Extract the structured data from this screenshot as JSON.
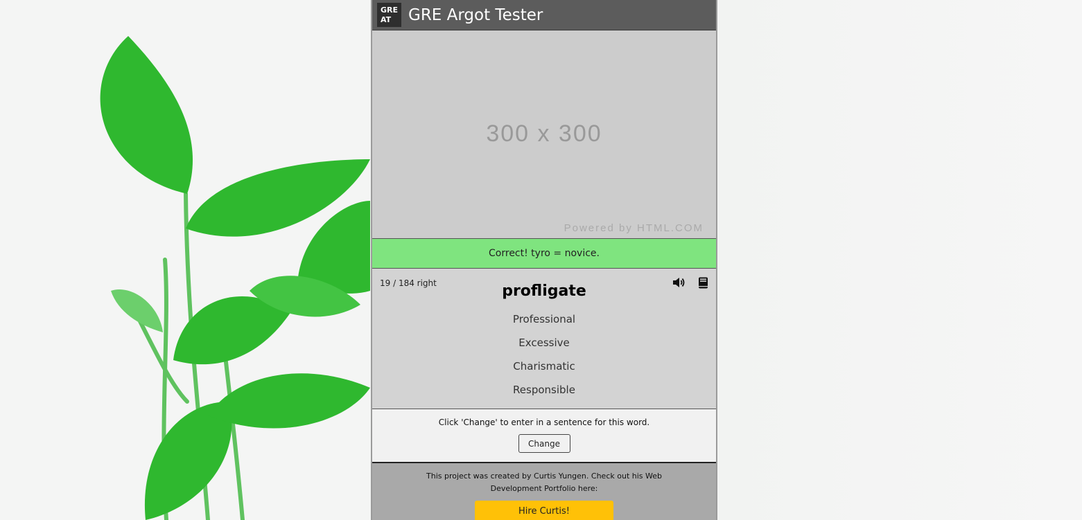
{
  "header": {
    "logo_line1": "GRE",
    "logo_line2": "AT",
    "title": "GRE Argot Tester"
  },
  "ad": {
    "size_text": "300 x 300",
    "powered_text": "Powered by HTML.COM"
  },
  "feedback": {
    "text": "Correct! tyro = novice.",
    "color": "#7fe47f"
  },
  "quiz": {
    "score_text": "19 / 184 right",
    "word": "profligate",
    "options": [
      "Professional",
      "Excessive",
      "Charismatic",
      "Responsible"
    ],
    "icons": [
      "volume-icon",
      "dictionary-icon"
    ]
  },
  "sentence": {
    "prompt": "Click 'Change' to enter in a sentence for this word.",
    "button_label": "Change"
  },
  "footer": {
    "text": "This project was created by Curtis Yungen. Check out his Web Development Portfolio here:",
    "button_label": "Hire Curtis!",
    "button_color": "#ffc107"
  }
}
